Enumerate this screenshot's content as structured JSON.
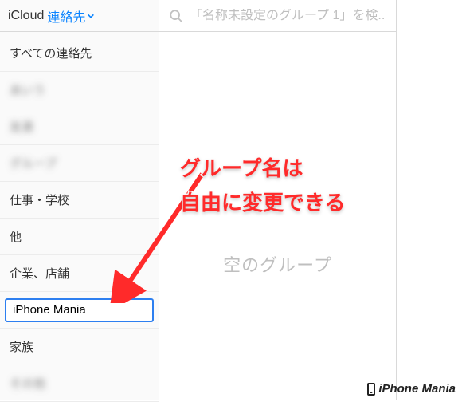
{
  "header": {
    "brand": "iCloud",
    "dropdown": "連絡先"
  },
  "sidebar": {
    "items": [
      {
        "label": "すべての連絡先",
        "blurred": false
      },
      {
        "label": "あいう",
        "blurred": true
      },
      {
        "label": "友達",
        "blurred": true
      },
      {
        "label": "グループ",
        "blurred": true
      },
      {
        "label": "仕事・学校",
        "blurred": false
      },
      {
        "label": "他",
        "blurred": false
      },
      {
        "label": "企業、店舗",
        "blurred": false
      },
      {
        "label": "iPhone Mania",
        "blurred": false,
        "editing": true
      },
      {
        "label": "家族",
        "blurred": false
      },
      {
        "label": "その他",
        "blurred": true
      }
    ]
  },
  "search": {
    "placeholder": "「名称未設定のグループ 1」を検..."
  },
  "main": {
    "empty": "空のグループ"
  },
  "annotation": {
    "line1": "グループ名は",
    "line2": "自由に変更できる"
  },
  "watermark": "iPhone Mania"
}
